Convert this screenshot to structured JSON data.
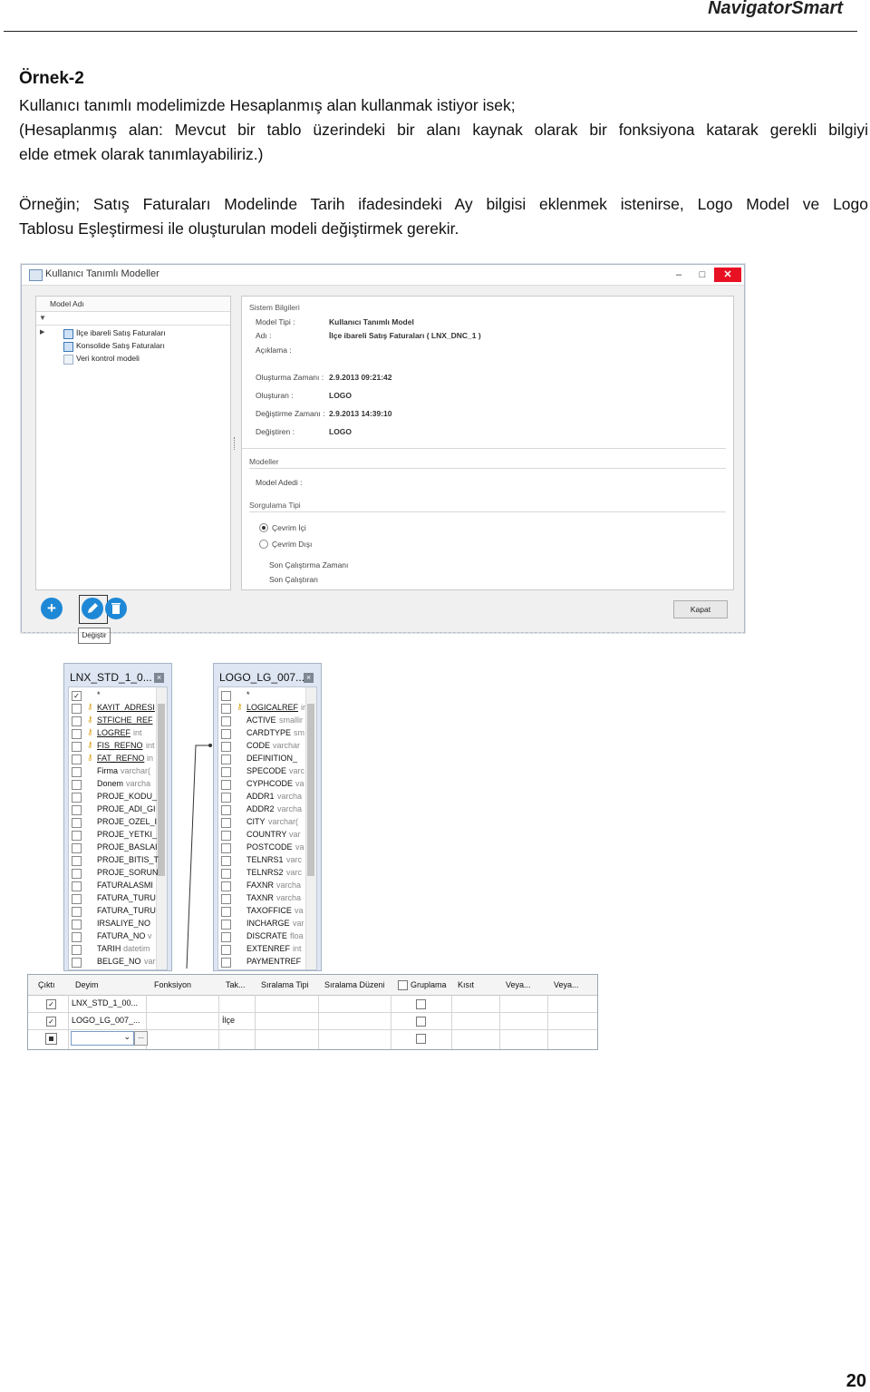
{
  "header": {
    "brand": "NavigatorSmart"
  },
  "doc": {
    "title": "Örnek-2",
    "line1": "Kullanıcı tanımlı modelimizde Hesaplanmış alan kullanmak istiyor isek;",
    "line2": "(Hesaplanmış alan: Mevcut bir tablo üzerindeki bir alanı kaynak olarak bir fonksiyona katarak gerekli bilgiyi",
    "line3": "elde etmek olarak tanımlayabiliriz.)",
    "para2_line1": "Örneğin; Satış Faturaları Modelinde Tarih ifadesindeki Ay bilgisi eklenmek istenirse, Logo Model ve Logo",
    "para2_line2": "Tablosu Eşleştirmesi ile oluşturulan modeli değiştirmek gerekir."
  },
  "dialog": {
    "title": "Kullanıcı Tanımlı Modeller",
    "window_buttons": {
      "minimize": "–",
      "maximize": "□",
      "close": "✕"
    },
    "model_list": {
      "header": "Model Adı",
      "filter_icon": "filter-icon",
      "items": [
        {
          "label": "İlçe ibareli Satış Faturaları"
        },
        {
          "label": "Konsolide Satış Faturaları"
        },
        {
          "label": "Veri kontrol modeli"
        }
      ]
    },
    "system_info": {
      "group_label": "Sistem Bilgileri",
      "model_type_label": "Model Tipi :",
      "model_type_value": "Kullanıcı Tanımlı Model",
      "name_label": "Adı :",
      "name_value": "İlçe ibareli Satış Faturaları ( LNX_DNC_1 )",
      "description_label": "Açıklama :",
      "created_time_label": "Oluşturma Zamanı :",
      "created_time_value": "2.9.2013 09:21:42",
      "created_by_label": "Oluşturan :",
      "created_by_value": "LOGO",
      "modified_time_label": "Değiştirme Zamanı :",
      "modified_time_value": "2.9.2013 14:39:10",
      "modified_by_label": "Değiştiren :",
      "modified_by_value": "LOGO"
    },
    "models_group": {
      "label": "Modeller",
      "count_label": "Model Adedi :"
    },
    "query_type": {
      "label": "Sorgulama Tipi",
      "option_online": "Çevrim İçi",
      "option_offline": "Çevrim Dışı",
      "last_run_time": "Son Çalıştırma Zamanı",
      "last_run_by": "Son Çalıştıran",
      "selected": "online"
    },
    "toolbar": {
      "add_icon": "plus-icon",
      "edit_icon": "pencil-icon",
      "delete_icon": "trash-icon",
      "edit_tooltip": "Değiştir",
      "close_label": "Kapat"
    }
  },
  "tables": [
    {
      "name": "LNX_STD_1_0...",
      "columns": [
        {
          "name": "*",
          "type": "",
          "key": false,
          "checked": true
        },
        {
          "name": "KAYIT_ADRESI",
          "type": "",
          "key": true,
          "checked": false
        },
        {
          "name": "STFICHE_REF",
          "type": "",
          "key": true,
          "checked": false
        },
        {
          "name": "LOGREF",
          "type": "int",
          "key": true,
          "checked": false
        },
        {
          "name": "FIS_REFNO",
          "type": "int",
          "key": true,
          "checked": false
        },
        {
          "name": "FAT_REFNO",
          "type": "in",
          "key": true,
          "checked": false
        },
        {
          "name": "Firma",
          "type": "varchar(",
          "key": false,
          "checked": false
        },
        {
          "name": "Donem",
          "type": "varcha",
          "key": false,
          "checked": false
        },
        {
          "name": "PROJE_KODU_",
          "type": "",
          "key": false,
          "checked": false
        },
        {
          "name": "PROJE_ADI_GI",
          "type": "",
          "key": false,
          "checked": false
        },
        {
          "name": "PROJE_OZEL_I",
          "type": "",
          "key": false,
          "checked": false
        },
        {
          "name": "PROJE_YETKI_",
          "type": "",
          "key": false,
          "checked": false
        },
        {
          "name": "PROJE_BASLAI",
          "type": "",
          "key": false,
          "checked": false
        },
        {
          "name": "PROJE_BITIS_T",
          "type": "",
          "key": false,
          "checked": false
        },
        {
          "name": "PROJE_SORUN",
          "type": "",
          "key": false,
          "checked": false
        },
        {
          "name": "FATURALASMI",
          "type": "",
          "key": false,
          "checked": false
        },
        {
          "name": "FATURA_TURU",
          "type": "",
          "key": false,
          "checked": false
        },
        {
          "name": "FATURA_TURU",
          "type": "",
          "key": false,
          "checked": false
        },
        {
          "name": "IRSALIYE_NO",
          "type": "",
          "key": false,
          "checked": false
        },
        {
          "name": "FATURA_NO",
          "type": "v",
          "key": false,
          "checked": false
        },
        {
          "name": "TARIH",
          "type": "datetim",
          "key": false,
          "checked": false
        },
        {
          "name": "BELGE_NO",
          "type": "var",
          "key": false,
          "checked": false
        }
      ]
    },
    {
      "name": "LOGO_LG_007...",
      "columns": [
        {
          "name": "*",
          "type": "",
          "key": false,
          "checked": false
        },
        {
          "name": "LOGICALREF",
          "type": "ir",
          "key": true,
          "checked": false
        },
        {
          "name": "ACTIVE",
          "type": "smallir",
          "key": false,
          "checked": false
        },
        {
          "name": "CARDTYPE",
          "type": "sm",
          "key": false,
          "checked": false
        },
        {
          "name": "CODE",
          "type": "varchar",
          "key": false,
          "checked": false
        },
        {
          "name": "DEFINITION_",
          "type": "",
          "key": false,
          "checked": false
        },
        {
          "name": "SPECODE",
          "type": "varc",
          "key": false,
          "checked": false
        },
        {
          "name": "CYPHCODE",
          "type": "va",
          "key": false,
          "checked": false
        },
        {
          "name": "ADDR1",
          "type": "varcha",
          "key": false,
          "checked": false
        },
        {
          "name": "ADDR2",
          "type": "varcha",
          "key": false,
          "checked": false
        },
        {
          "name": "CITY",
          "type": "varchar(",
          "key": false,
          "checked": false
        },
        {
          "name": "COUNTRY",
          "type": "var",
          "key": false,
          "checked": false
        },
        {
          "name": "POSTCODE",
          "type": "va",
          "key": false,
          "checked": false
        },
        {
          "name": "TELNRS1",
          "type": "varc",
          "key": false,
          "checked": false
        },
        {
          "name": "TELNRS2",
          "type": "varc",
          "key": false,
          "checked": false
        },
        {
          "name": "FAXNR",
          "type": "varcha",
          "key": false,
          "checked": false
        },
        {
          "name": "TAXNR",
          "type": "varcha",
          "key": false,
          "checked": false
        },
        {
          "name": "TAXOFFICE",
          "type": "va",
          "key": false,
          "checked": false
        },
        {
          "name": "INCHARGE",
          "type": "var",
          "key": false,
          "checked": false
        },
        {
          "name": "DISCRATE",
          "type": "floa",
          "key": false,
          "checked": false
        },
        {
          "name": "EXTENREF",
          "type": "int",
          "key": false,
          "checked": false
        },
        {
          "name": "PAYMENTREF",
          "type": "",
          "key": false,
          "checked": false
        }
      ]
    }
  ],
  "grid": {
    "headers": [
      "Çıktı",
      "Deyim",
      "Fonksiyon",
      "Tak...",
      "Sıralama Tipi",
      "Sıralama Düzeni",
      "Gruplama",
      "Kısıt",
      "Veya...",
      "Veya..."
    ],
    "rows": [
      {
        "output": true,
        "expression": "LNX_STD_1_00...",
        "alias": "",
        "grouping": false
      },
      {
        "output": true,
        "expression": "LOGO_LG_007_...",
        "alias": "İlçe",
        "grouping": false
      },
      {
        "output": false,
        "expression": "",
        "alias": "",
        "grouping": false
      }
    ],
    "new_row_button": "..."
  },
  "footer": {
    "page_number": "20"
  }
}
